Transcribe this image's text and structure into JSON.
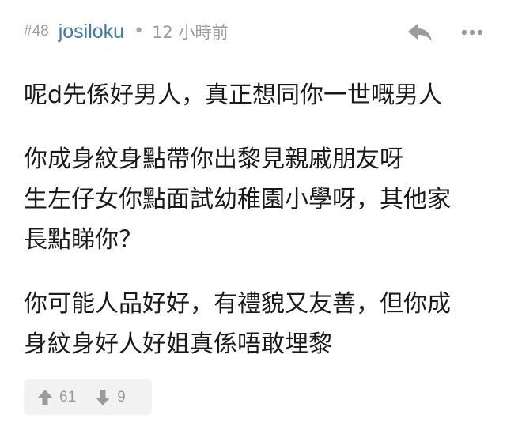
{
  "post": {
    "floor": "#48",
    "username": "josiloku",
    "separator": "•",
    "time": "12 小時前",
    "paragraphs": [
      [
        "呢d先係好男人，真正想同你一世嘅男人"
      ],
      [
        "你成身紋身點帶你出黎見親戚朋友呀",
        "生左仔女你點面試幼稚園小學呀，其他家",
        "長點睇你？"
      ],
      [
        "你可能人品好好，有禮貌又友善，但你成",
        "身紋身好人好姐真係唔敢埋黎"
      ]
    ],
    "upvotes": "61",
    "downvotes": "9"
  },
  "icons": {
    "reply": "reply-arrow-icon",
    "more": "more-dots-icon",
    "upvote": "arrow-up-icon",
    "downvote": "arrow-down-icon"
  },
  "colors": {
    "username": "#3f7aa8",
    "meta": "#9b9b9b",
    "icon": "#9b9b9b",
    "vote_bg": "#f2f2f2",
    "text": "#1a1a1a"
  }
}
